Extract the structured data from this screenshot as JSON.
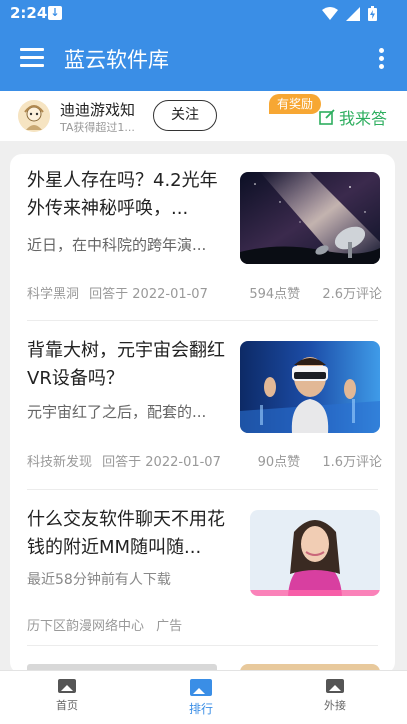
{
  "status": {
    "time": "2:24"
  },
  "appbar": {
    "title": "蓝云软件库"
  },
  "user": {
    "name": "迪迪游戏知",
    "subtitle": "TA获得超过1...",
    "follow_label": "关注",
    "reward_badge": "有奖励",
    "answer_label": "我来答"
  },
  "feed": [
    {
      "title": "外星人存在吗？4.2光年外传来神秘呼唤，...",
      "desc": "近日，在中科院的跨年演...",
      "source": "科学黑洞",
      "answered": "回答于 2022-01-07",
      "likes": "594点赞",
      "comments": "2.6万评论",
      "thumb": "milky-way-radio-telescope"
    },
    {
      "title": "背靠大树，元宇宙会翻红VR设备吗？",
      "desc": "元宇宙红了之后，配套的...",
      "source": "科技新发现",
      "answered": "回答于 2022-01-07",
      "likes": "90点赞",
      "comments": "1.6万评论",
      "thumb": "man-wearing-vr-headset"
    },
    {
      "title": "什么交友软件聊天不用花钱的附近MM随叫随...",
      "desc": "最近58分钟前有人下载",
      "source": "历下区韵漫网络中心",
      "ad_label": "广告",
      "thumb": "woman-pink-sweater"
    }
  ],
  "tabs": [
    {
      "label": "首页"
    },
    {
      "label": "排行"
    },
    {
      "label": "外接"
    }
  ],
  "colors": {
    "primary": "#3a8ee6",
    "answer_green": "#2eae5f",
    "reward_orange": "#f7a733"
  }
}
